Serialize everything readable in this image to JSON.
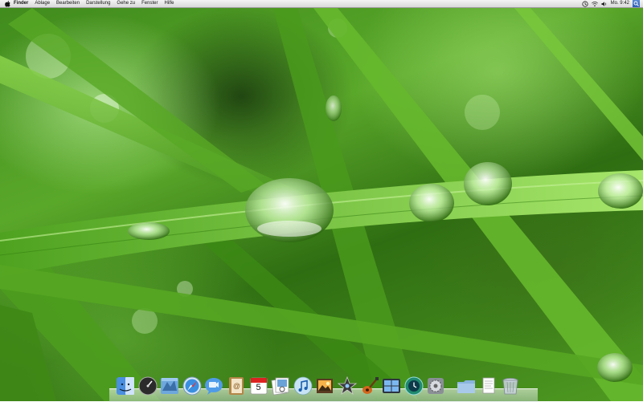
{
  "menubar": {
    "apple_icon": "apple-logo-icon",
    "items": [
      {
        "label": "Finder",
        "bold": true
      },
      {
        "label": "Ablage"
      },
      {
        "label": "Bearbeiten"
      },
      {
        "label": "Darstellung"
      },
      {
        "label": "Gehe zu"
      },
      {
        "label": "Fenster"
      },
      {
        "label": "Hilfe"
      }
    ],
    "status_icons": [
      "time-machine-icon",
      "wifi-icon",
      "volume-icon"
    ],
    "clock": "Mo. 9:42",
    "spotlight_icon": "spotlight-search-icon"
  },
  "desktop": {
    "wallpaper": "grass blades with water droplets",
    "colors": {
      "grass_dark": "#2f6d12",
      "grass_mid": "#5aa82a",
      "grass_light": "#9be063"
    }
  },
  "dock": {
    "apps": [
      {
        "name": "finder",
        "icon": "finder-icon"
      },
      {
        "name": "dashboard",
        "icon": "dashboard-icon"
      },
      {
        "name": "mail",
        "icon": "mail-icon"
      },
      {
        "name": "safari",
        "icon": "safari-icon"
      },
      {
        "name": "ichat",
        "icon": "ichat-icon"
      },
      {
        "name": "address-book",
        "icon": "address-book-icon"
      },
      {
        "name": "ical",
        "icon": "ical-icon",
        "badge": "5"
      },
      {
        "name": "preview",
        "icon": "preview-icon"
      },
      {
        "name": "itunes",
        "icon": "itunes-icon"
      },
      {
        "name": "iphoto",
        "icon": "iphoto-icon"
      },
      {
        "name": "imovie",
        "icon": "imovie-icon"
      },
      {
        "name": "garageband",
        "icon": "garageband-icon"
      },
      {
        "name": "spaces",
        "icon": "spaces-icon"
      },
      {
        "name": "time-machine",
        "icon": "time-machine-icon"
      },
      {
        "name": "system-preferences",
        "icon": "system-preferences-icon"
      }
    ],
    "stacks": [
      {
        "name": "applications-folder",
        "icon": "folder-stack-icon"
      },
      {
        "name": "documents-stack",
        "icon": "documents-stack-icon"
      },
      {
        "name": "trash",
        "icon": "trash-icon"
      }
    ]
  }
}
